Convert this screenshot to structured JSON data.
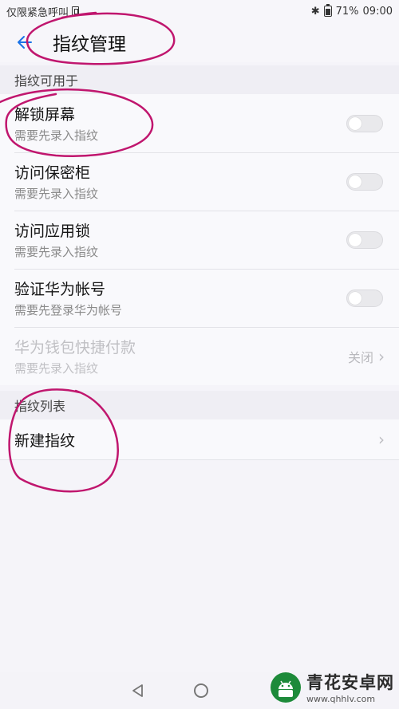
{
  "status_bar": {
    "carrier": "仅限紧急呼叫",
    "battery_percent": "71%",
    "time": "09:00"
  },
  "toolbar": {
    "title": "指纹管理"
  },
  "section1": {
    "header": "指纹可用于",
    "items": [
      {
        "title": "解锁屏幕",
        "subtitle": "需要先录入指纹",
        "toggle_on": false
      },
      {
        "title": "访问保密柜",
        "subtitle": "需要先录入指纹",
        "toggle_on": false
      },
      {
        "title": "访问应用锁",
        "subtitle": "需要先录入指纹",
        "toggle_on": false
      },
      {
        "title": "验证华为帐号",
        "subtitle": "需要先登录华为帐号",
        "toggle_on": false
      },
      {
        "title": "华为钱包快捷付款",
        "subtitle": "需要先录入指纹",
        "value": "关闭"
      }
    ]
  },
  "section2": {
    "header": "指纹列表",
    "items": [
      {
        "title": "新建指纹"
      }
    ]
  },
  "watermark": {
    "title": "青花安卓网",
    "url": "www.qhhlv.com"
  },
  "colors": {
    "accent": "#1a73e8",
    "annotation": "#c0166e"
  }
}
